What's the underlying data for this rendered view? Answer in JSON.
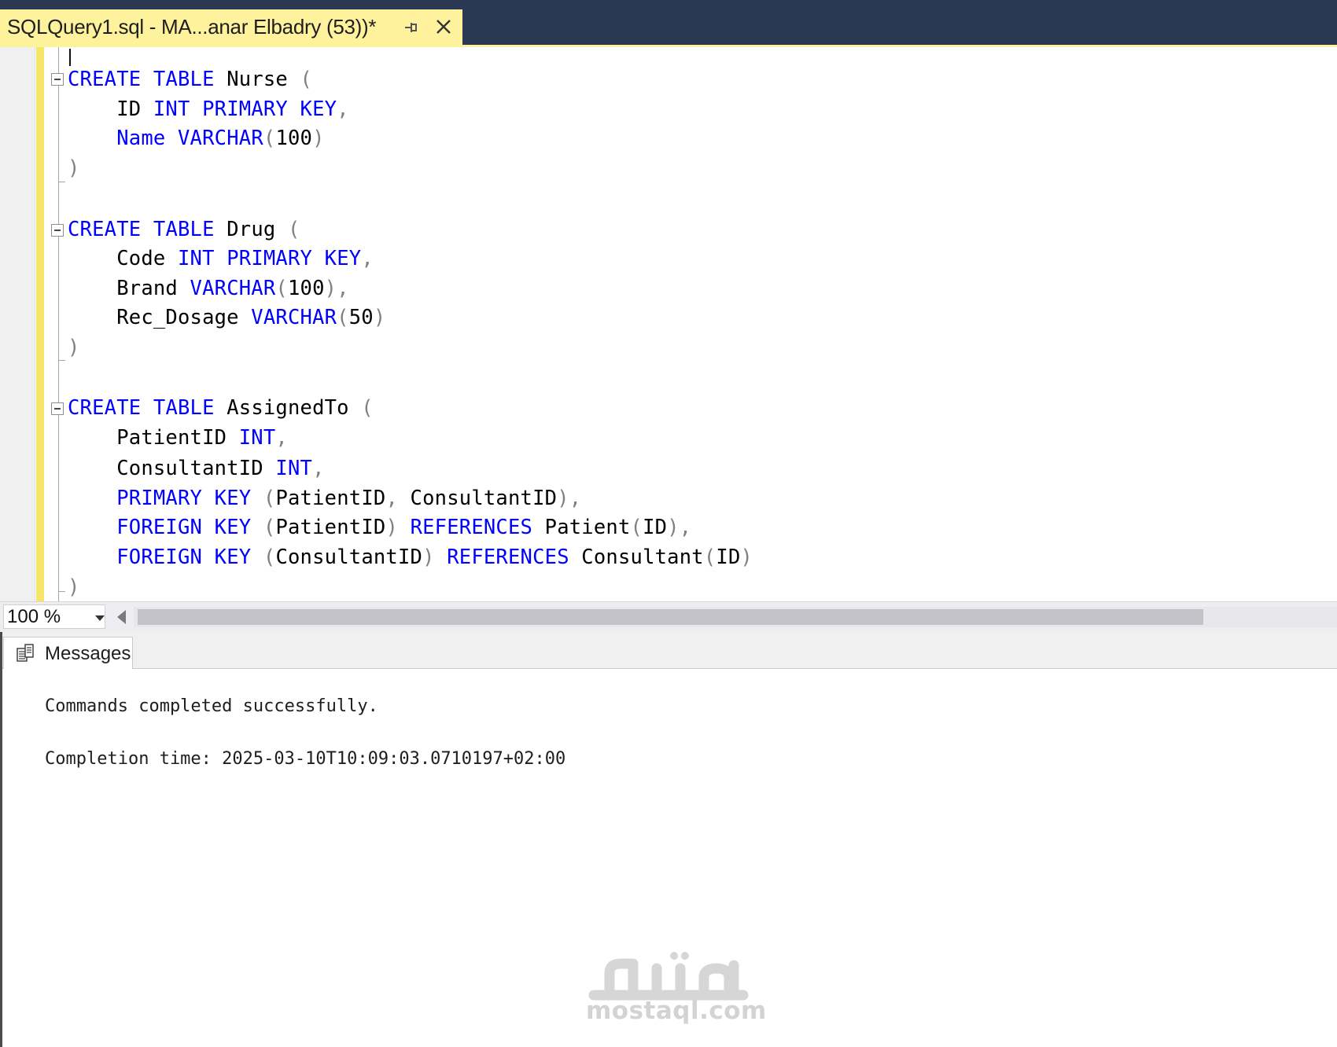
{
  "tab": {
    "title": "SQLQuery1.sql - MA...anar Elbadry (53))*",
    "pin_icon": "pin-icon",
    "close_icon": "close-icon"
  },
  "colors": {
    "keyword": "#0000ff",
    "identifier": "#000000",
    "punctuation": "#808080",
    "tab_active": "#fff29d",
    "title_bar": "#2b3853",
    "change_marker": "#f5e66a"
  },
  "editor": {
    "lines": [
      [
        {
          "t": "CREATE",
          "c": "kw"
        },
        {
          "t": " ",
          "c": "id"
        },
        {
          "t": "TABLE",
          "c": "kw"
        },
        {
          "t": " Nurse ",
          "c": "id"
        },
        {
          "t": "(",
          "c": "pu"
        }
      ],
      [
        {
          "t": "    ID ",
          "c": "id"
        },
        {
          "t": "INT",
          "c": "kw"
        },
        {
          "t": " ",
          "c": "id"
        },
        {
          "t": "PRIMARY",
          "c": "kw"
        },
        {
          "t": " ",
          "c": "id"
        },
        {
          "t": "KEY",
          "c": "kw"
        },
        {
          "t": ",",
          "c": "pu"
        }
      ],
      [
        {
          "t": "    ",
          "c": "id"
        },
        {
          "t": "Name",
          "c": "kw"
        },
        {
          "t": " ",
          "c": "id"
        },
        {
          "t": "VARCHAR",
          "c": "kw"
        },
        {
          "t": "(",
          "c": "pu"
        },
        {
          "t": "100",
          "c": "id"
        },
        {
          "t": ")",
          "c": "pu"
        }
      ],
      [
        {
          "t": ")",
          "c": "pu"
        }
      ],
      [],
      [
        {
          "t": "CREATE",
          "c": "kw"
        },
        {
          "t": " ",
          "c": "id"
        },
        {
          "t": "TABLE",
          "c": "kw"
        },
        {
          "t": " Drug ",
          "c": "id"
        },
        {
          "t": "(",
          "c": "pu"
        }
      ],
      [
        {
          "t": "    Code ",
          "c": "id"
        },
        {
          "t": "INT",
          "c": "kw"
        },
        {
          "t": " ",
          "c": "id"
        },
        {
          "t": "PRIMARY",
          "c": "kw"
        },
        {
          "t": " ",
          "c": "id"
        },
        {
          "t": "KEY",
          "c": "kw"
        },
        {
          "t": ",",
          "c": "pu"
        }
      ],
      [
        {
          "t": "    Brand ",
          "c": "id"
        },
        {
          "t": "VARCHAR",
          "c": "kw"
        },
        {
          "t": "(",
          "c": "pu"
        },
        {
          "t": "100",
          "c": "id"
        },
        {
          "t": "),",
          "c": "pu"
        }
      ],
      [
        {
          "t": "    Rec_Dosage ",
          "c": "id"
        },
        {
          "t": "VARCHAR",
          "c": "kw"
        },
        {
          "t": "(",
          "c": "pu"
        },
        {
          "t": "50",
          "c": "id"
        },
        {
          "t": ")",
          "c": "pu"
        }
      ],
      [
        {
          "t": ")",
          "c": "pu"
        }
      ],
      [],
      [
        {
          "t": "CREATE",
          "c": "kw"
        },
        {
          "t": " ",
          "c": "id"
        },
        {
          "t": "TABLE",
          "c": "kw"
        },
        {
          "t": " AssignedTo ",
          "c": "id"
        },
        {
          "t": "(",
          "c": "pu"
        }
      ],
      [
        {
          "t": "    PatientID ",
          "c": "id"
        },
        {
          "t": "INT",
          "c": "kw"
        },
        {
          "t": ",",
          "c": "pu"
        }
      ],
      [
        {
          "t": "    ConsultantID ",
          "c": "id"
        },
        {
          "t": "INT",
          "c": "kw"
        },
        {
          "t": ",",
          "c": "pu"
        }
      ],
      [
        {
          "t": "    ",
          "c": "id"
        },
        {
          "t": "PRIMARY",
          "c": "kw"
        },
        {
          "t": " ",
          "c": "id"
        },
        {
          "t": "KEY",
          "c": "kw"
        },
        {
          "t": " ",
          "c": "id"
        },
        {
          "t": "(",
          "c": "pu"
        },
        {
          "t": "PatientID",
          "c": "id"
        },
        {
          "t": ",",
          "c": "pu"
        },
        {
          "t": " ConsultantID",
          "c": "id"
        },
        {
          "t": "),",
          "c": "pu"
        }
      ],
      [
        {
          "t": "    ",
          "c": "id"
        },
        {
          "t": "FOREIGN",
          "c": "kw"
        },
        {
          "t": " ",
          "c": "id"
        },
        {
          "t": "KEY",
          "c": "kw"
        },
        {
          "t": " ",
          "c": "id"
        },
        {
          "t": "(",
          "c": "pu"
        },
        {
          "t": "PatientID",
          "c": "id"
        },
        {
          "t": ")",
          "c": "pu"
        },
        {
          "t": " ",
          "c": "id"
        },
        {
          "t": "REFERENCES",
          "c": "kw"
        },
        {
          "t": " Patient",
          "c": "id"
        },
        {
          "t": "(",
          "c": "pu"
        },
        {
          "t": "ID",
          "c": "id"
        },
        {
          "t": "),",
          "c": "pu"
        }
      ],
      [
        {
          "t": "    ",
          "c": "id"
        },
        {
          "t": "FOREIGN",
          "c": "kw"
        },
        {
          "t": " ",
          "c": "id"
        },
        {
          "t": "KEY",
          "c": "kw"
        },
        {
          "t": " ",
          "c": "id"
        },
        {
          "t": "(",
          "c": "pu"
        },
        {
          "t": "ConsultantID",
          "c": "id"
        },
        {
          "t": ")",
          "c": "pu"
        },
        {
          "t": " ",
          "c": "id"
        },
        {
          "t": "REFERENCES",
          "c": "kw"
        },
        {
          "t": " Consultant",
          "c": "id"
        },
        {
          "t": "(",
          "c": "pu"
        },
        {
          "t": "ID",
          "c": "id"
        },
        {
          "t": ")",
          "c": "pu"
        }
      ],
      [
        {
          "t": ")",
          "c": "pu"
        }
      ]
    ]
  },
  "zoom": {
    "value": "100 %"
  },
  "results": {
    "tab_label": "Messages",
    "tab_icon": "messages-icon",
    "lines": [
      "Commands completed successfully.",
      "Completion time: 2025-03-10T10:09:03.0710197+02:00"
    ]
  },
  "watermark": {
    "logo_icon": "mostaql-logo-icon",
    "text": "mostaql.com"
  }
}
